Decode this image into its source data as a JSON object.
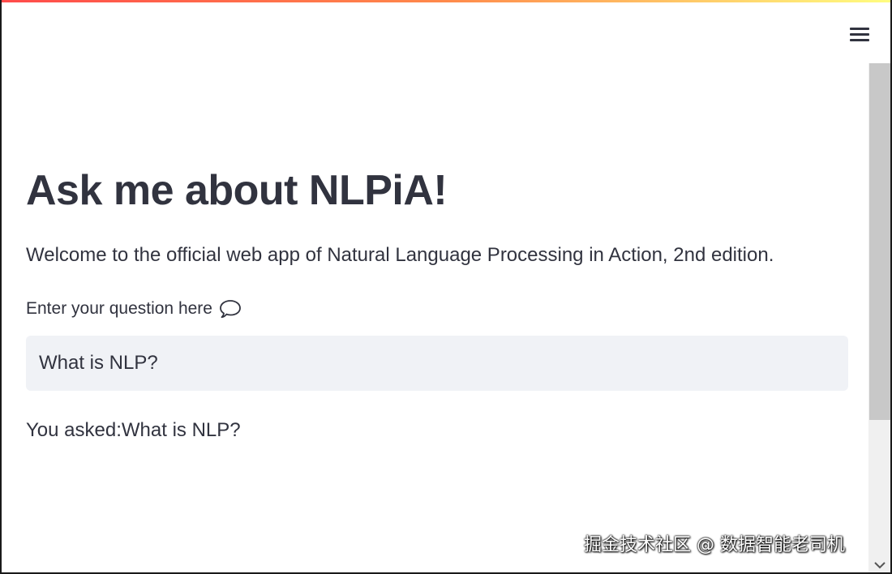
{
  "header": {
    "menu_icon": "hamburger-menu-icon",
    "decoration_colors": [
      "#ff4b4b",
      "#ff8a4b",
      "#fffd80"
    ]
  },
  "main": {
    "title": "Ask me about NLPiA!",
    "welcome_text": "Welcome to the official web app of Natural Language Processing in Action, 2nd edition.",
    "input_label": "Enter your question here",
    "input_label_icon": "speech-bubble-icon",
    "question_input_value": "What is NLP?",
    "answer_text": "You asked:What is NLP?"
  },
  "watermark": {
    "text": "掘金技术社区 @ 数据智能老司机"
  },
  "theme": {
    "input_background": "#f0f2f6",
    "text_color": "#31333f"
  }
}
